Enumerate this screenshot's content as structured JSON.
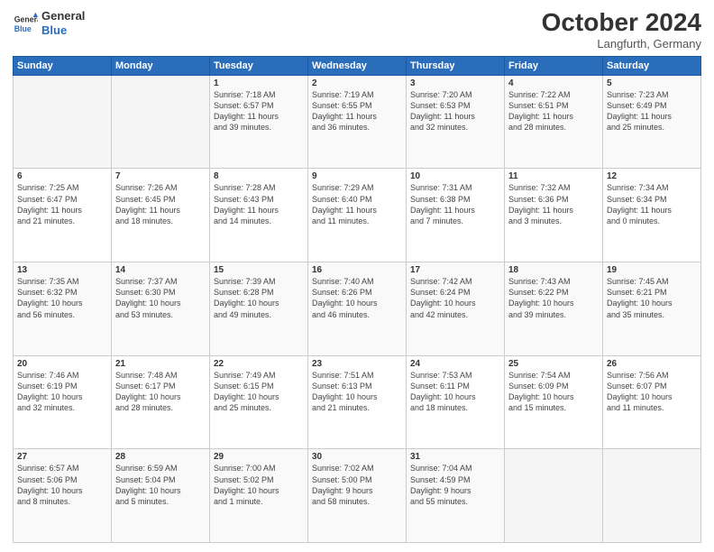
{
  "header": {
    "logo_line1": "General",
    "logo_line2": "Blue",
    "month": "October 2024",
    "location": "Langfurth, Germany"
  },
  "weekdays": [
    "Sunday",
    "Monday",
    "Tuesday",
    "Wednesday",
    "Thursday",
    "Friday",
    "Saturday"
  ],
  "weeks": [
    [
      {
        "day": "",
        "info": ""
      },
      {
        "day": "",
        "info": ""
      },
      {
        "day": "1",
        "info": "Sunrise: 7:18 AM\nSunset: 6:57 PM\nDaylight: 11 hours\nand 39 minutes."
      },
      {
        "day": "2",
        "info": "Sunrise: 7:19 AM\nSunset: 6:55 PM\nDaylight: 11 hours\nand 36 minutes."
      },
      {
        "day": "3",
        "info": "Sunrise: 7:20 AM\nSunset: 6:53 PM\nDaylight: 11 hours\nand 32 minutes."
      },
      {
        "day": "4",
        "info": "Sunrise: 7:22 AM\nSunset: 6:51 PM\nDaylight: 11 hours\nand 28 minutes."
      },
      {
        "day": "5",
        "info": "Sunrise: 7:23 AM\nSunset: 6:49 PM\nDaylight: 11 hours\nand 25 minutes."
      }
    ],
    [
      {
        "day": "6",
        "info": "Sunrise: 7:25 AM\nSunset: 6:47 PM\nDaylight: 11 hours\nand 21 minutes."
      },
      {
        "day": "7",
        "info": "Sunrise: 7:26 AM\nSunset: 6:45 PM\nDaylight: 11 hours\nand 18 minutes."
      },
      {
        "day": "8",
        "info": "Sunrise: 7:28 AM\nSunset: 6:43 PM\nDaylight: 11 hours\nand 14 minutes."
      },
      {
        "day": "9",
        "info": "Sunrise: 7:29 AM\nSunset: 6:40 PM\nDaylight: 11 hours\nand 11 minutes."
      },
      {
        "day": "10",
        "info": "Sunrise: 7:31 AM\nSunset: 6:38 PM\nDaylight: 11 hours\nand 7 minutes."
      },
      {
        "day": "11",
        "info": "Sunrise: 7:32 AM\nSunset: 6:36 PM\nDaylight: 11 hours\nand 3 minutes."
      },
      {
        "day": "12",
        "info": "Sunrise: 7:34 AM\nSunset: 6:34 PM\nDaylight: 11 hours\nand 0 minutes."
      }
    ],
    [
      {
        "day": "13",
        "info": "Sunrise: 7:35 AM\nSunset: 6:32 PM\nDaylight: 10 hours\nand 56 minutes."
      },
      {
        "day": "14",
        "info": "Sunrise: 7:37 AM\nSunset: 6:30 PM\nDaylight: 10 hours\nand 53 minutes."
      },
      {
        "day": "15",
        "info": "Sunrise: 7:39 AM\nSunset: 6:28 PM\nDaylight: 10 hours\nand 49 minutes."
      },
      {
        "day": "16",
        "info": "Sunrise: 7:40 AM\nSunset: 6:26 PM\nDaylight: 10 hours\nand 46 minutes."
      },
      {
        "day": "17",
        "info": "Sunrise: 7:42 AM\nSunset: 6:24 PM\nDaylight: 10 hours\nand 42 minutes."
      },
      {
        "day": "18",
        "info": "Sunrise: 7:43 AM\nSunset: 6:22 PM\nDaylight: 10 hours\nand 39 minutes."
      },
      {
        "day": "19",
        "info": "Sunrise: 7:45 AM\nSunset: 6:21 PM\nDaylight: 10 hours\nand 35 minutes."
      }
    ],
    [
      {
        "day": "20",
        "info": "Sunrise: 7:46 AM\nSunset: 6:19 PM\nDaylight: 10 hours\nand 32 minutes."
      },
      {
        "day": "21",
        "info": "Sunrise: 7:48 AM\nSunset: 6:17 PM\nDaylight: 10 hours\nand 28 minutes."
      },
      {
        "day": "22",
        "info": "Sunrise: 7:49 AM\nSunset: 6:15 PM\nDaylight: 10 hours\nand 25 minutes."
      },
      {
        "day": "23",
        "info": "Sunrise: 7:51 AM\nSunset: 6:13 PM\nDaylight: 10 hours\nand 21 minutes."
      },
      {
        "day": "24",
        "info": "Sunrise: 7:53 AM\nSunset: 6:11 PM\nDaylight: 10 hours\nand 18 minutes."
      },
      {
        "day": "25",
        "info": "Sunrise: 7:54 AM\nSunset: 6:09 PM\nDaylight: 10 hours\nand 15 minutes."
      },
      {
        "day": "26",
        "info": "Sunrise: 7:56 AM\nSunset: 6:07 PM\nDaylight: 10 hours\nand 11 minutes."
      }
    ],
    [
      {
        "day": "27",
        "info": "Sunrise: 6:57 AM\nSunset: 5:06 PM\nDaylight: 10 hours\nand 8 minutes."
      },
      {
        "day": "28",
        "info": "Sunrise: 6:59 AM\nSunset: 5:04 PM\nDaylight: 10 hours\nand 5 minutes."
      },
      {
        "day": "29",
        "info": "Sunrise: 7:00 AM\nSunset: 5:02 PM\nDaylight: 10 hours\nand 1 minute."
      },
      {
        "day": "30",
        "info": "Sunrise: 7:02 AM\nSunset: 5:00 PM\nDaylight: 9 hours\nand 58 minutes."
      },
      {
        "day": "31",
        "info": "Sunrise: 7:04 AM\nSunset: 4:59 PM\nDaylight: 9 hours\nand 55 minutes."
      },
      {
        "day": "",
        "info": ""
      },
      {
        "day": "",
        "info": ""
      }
    ]
  ]
}
